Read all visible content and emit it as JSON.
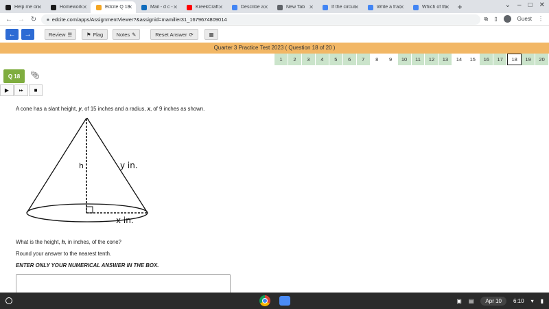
{
  "browser": {
    "tabs": [
      {
        "title": "Help me on",
        "color": "#1a1a1a",
        "active": false
      },
      {
        "title": "Homework",
        "color": "#1a1a1a",
        "active": false
      },
      {
        "title": "Edcite Q 18",
        "color": "#f4a623",
        "active": true
      },
      {
        "title": "Mail - d c -",
        "color": "#0f6cbd",
        "active": false
      },
      {
        "title": "KreekCraft",
        "color": "#ff0000",
        "active": false
      },
      {
        "title": "Describe a",
        "color": "#4285f4",
        "active": false
      },
      {
        "title": "New Tab",
        "color": "#5f6368",
        "active": false
      },
      {
        "title": "If the circum",
        "color": "#4285f4",
        "active": false
      },
      {
        "title": "Write a fract",
        "color": "#4285f4",
        "active": false
      },
      {
        "title": "Which of the",
        "color": "#4285f4",
        "active": false
      }
    ],
    "url": "edcite.com/apps/AssignmentViewer?&assignid=mamiller31_1679674809014",
    "profile_label": "Guest"
  },
  "toolbar": {
    "review_label": "Review",
    "flag_label": "Flag",
    "notes_label": "Notes",
    "reset_label": "Reset Answer"
  },
  "test_title": "Quarter 3 Practice Test 2023 ( Question 18 of 20 )",
  "question_nav": {
    "numbers": [
      "1",
      "2",
      "3",
      "4",
      "5",
      "6",
      "7",
      "8",
      "9",
      "10",
      "11",
      "12",
      "13",
      "14",
      "15",
      "16",
      "17",
      "18",
      "19",
      "20"
    ],
    "unanswered": [
      "8",
      "9",
      "14",
      "15",
      "18"
    ],
    "current": "18"
  },
  "question": {
    "badge": "Q 18",
    "prompt_pre": "A cone has a slant height, ",
    "prompt_y": "y",
    "prompt_mid": ", of 15 inches and a radius, ",
    "prompt_x": "x",
    "prompt_post": ", of 9 inches as shown.",
    "ask_pre": "What is the height, ",
    "ask_h": "h",
    "ask_post": ", in inches, of the cone?",
    "round_text": "Round your answer to the nearest tenth.",
    "instruction": "ENTER ONLY YOUR NUMERICAL ANSWER IN THE BOX."
  },
  "figure": {
    "label_h": "h",
    "label_y": "y in.",
    "label_x": "x in."
  },
  "answer": {
    "value": ""
  },
  "shelf": {
    "date": "Apr 10",
    "time": "6:10"
  }
}
